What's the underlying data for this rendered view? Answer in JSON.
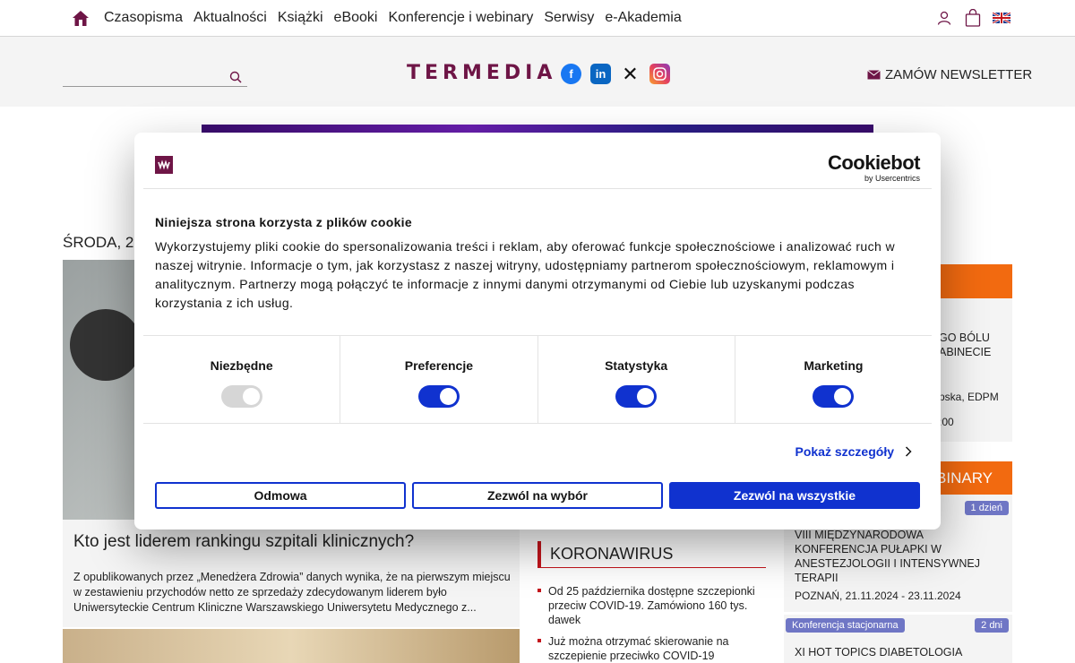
{
  "nav": {
    "items": [
      "Czasopisma",
      "Aktualności",
      "Książki",
      "eBooki",
      "Konferencje i webinary",
      "Serwisy",
      "e-Akademia"
    ],
    "home_icon": "home-icon",
    "right_icons": [
      "user-icon",
      "cart-icon",
      "uk-flag-icon"
    ]
  },
  "header": {
    "logo_text": "TERMEDIA",
    "social": [
      "facebook-icon",
      "linkedin-icon",
      "x-icon",
      "instagram-icon"
    ],
    "newsletter_label": "ZAMÓW NEWSLETTER",
    "search_placeholder": ""
  },
  "main": {
    "date_label": "ŚRODA, 20",
    "lead": {
      "title": "Kto jest liderem rankingu szpitali klinicznych?",
      "text": "Z opublikowanych przez „Menedżera Zdrowia” danych wynika, że na pierwszym miejscu w zestawieniu przychodów netto ze sprzedaży zdecydowanym liderem było Uniwersyteckie Centrum Kliniczne Warszawskiego Uniwersytetu Medycznego z..."
    }
  },
  "koronawirus": {
    "heading": "KORONAWIRUS",
    "items": [
      "Od 25 października dostępne szczepionki przeciw COVID-19. Zamówiono 160 tys. dawek",
      "Już można otrzymać skierowanie na szczepienie przeciwko COVID-19"
    ]
  },
  "right": {
    "event1_lines": [
      "GO BÓLU",
      "ABINECIE"
    ],
    "event1_author": "pska, EDPM",
    "event1_time": ":00",
    "webinary_label": "EBINARY",
    "events": [
      {
        "badge": "1 dzień",
        "title": "VIII MIĘDZYNARODOWA KONFERENCJA PUŁAPKI W ANESTEZJOLOGII I INTENSYWNEJ TERAPII",
        "place": "POZNAŃ, 21.11.2024 - 23.11.2024"
      },
      {
        "type": "Konferencja stacjonarna",
        "badge": "2 dni",
        "title": "XI HOT TOPICS DIABETOLOGIA"
      }
    ]
  },
  "cookie": {
    "brand": "Cookiebot",
    "brand_sub": "by Usercentrics",
    "title": "Niniejsza strona korzysta z plików cookie",
    "text": "Wykorzystujemy pliki cookie do spersonalizowania treści i reklam, aby oferować funkcje społecznościowe i analizować ruch w naszej witrynie. Informacje o tym, jak korzystasz z naszej witryny, udostępniamy partnerom społecznościowym, reklamowym i analitycznym. Partnerzy mogą połączyć te informacje z innymi danymi otrzymanymi od Ciebie lub uzyskanymi podczas korzystania z ich usług.",
    "categories": [
      {
        "label": "Niezbędne",
        "enabled": true,
        "disabled": true
      },
      {
        "label": "Preferencje",
        "enabled": true
      },
      {
        "label": "Statystyka",
        "enabled": true
      },
      {
        "label": "Marketing",
        "enabled": true
      }
    ],
    "details_label": "Pokaż szczegóły",
    "buttons": {
      "deny": "Odmowa",
      "allow_selection": "Zezwól na wybór",
      "allow_all": "Zezwól na wszystkie"
    },
    "accent": "#1032cf"
  },
  "colors": {
    "brand": "#6e1546",
    "orange": "#f26a10",
    "red": "#c4151c",
    "badge": "#6f76c5"
  }
}
